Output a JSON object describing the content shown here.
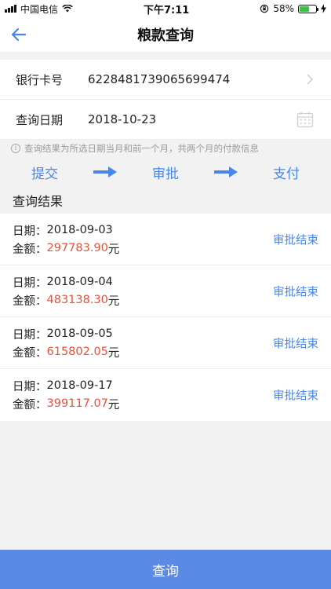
{
  "status_bar": {
    "carrier": "中国电信",
    "time": "下午7:11",
    "battery": "58%",
    "battery_level": 0.58
  },
  "nav": {
    "title": "粮款查询"
  },
  "form": {
    "card_label": "银行卡号",
    "card_value": "6228481739065699474",
    "date_label": "查询日期",
    "date_value": "2018-10-23"
  },
  "notice": "查询结果为所选日期当月和前一个月，共两个月的付款信息",
  "flow": {
    "step1": "提交",
    "step2": "审批",
    "step3": "支付"
  },
  "results": {
    "title": "查询结果",
    "date_prefix": "日期：",
    "amount_prefix": "金额：",
    "currency": "元",
    "items": [
      {
        "date": "2018-09-03",
        "amount": "297783.90",
        "status": "审批结束"
      },
      {
        "date": "2018-09-04",
        "amount": "483138.30",
        "status": "审批结束"
      },
      {
        "date": "2018-09-05",
        "amount": "615802.05",
        "status": "审批结束"
      },
      {
        "date": "2018-09-17",
        "amount": "399117.07",
        "status": "审批结束"
      }
    ]
  },
  "query_button": "查询",
  "colors": {
    "accent": "#4a86e8",
    "amount": "#e8513a",
    "button": "#5a8ae6"
  }
}
